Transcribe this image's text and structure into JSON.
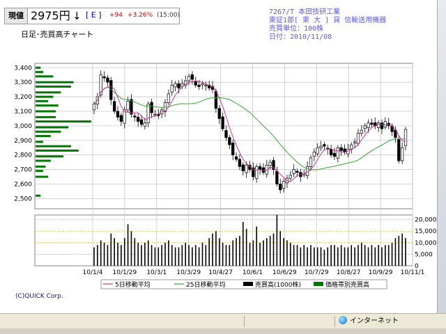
{
  "header": {
    "label": "現値",
    "price": "2975円",
    "arrow": "↓",
    "market_tag": "[ E ]",
    "change": "+94",
    "change_pct": "+3.26%",
    "time": "(15:00)"
  },
  "chart_title": "日足･売買高チャート",
  "info": {
    "code_name": "7267/T 本田技研工業",
    "market": "東証1部[ 東 大 ] 貸 信輸送用機器",
    "unit": "売買単位：100株",
    "date": "日付：2010/11/08"
  },
  "copyright": "(C)QUICK Corp.",
  "statusbar": {
    "internet": "インターネット"
  },
  "colors": {
    "candle": "#000000",
    "ma5": "#cc3399",
    "ma25": "#33aa33",
    "volume": "#000000",
    "price_volume": "#007700",
    "grid": "#c8c8c8",
    "volume_guide": "#e8b800"
  },
  "chart_data": {
    "type": "candlestick",
    "price_axis": {
      "ticks": [
        2500,
        2600,
        2700,
        2800,
        2900,
        3000,
        3100,
        3200,
        3300,
        3400
      ],
      "tick_labels": [
        "2,500",
        "2,600",
        "2,700",
        "2,800",
        "2,900",
        "3,000",
        "3,100",
        "3,200",
        "3,300",
        "3,400"
      ],
      "ylim": [
        2430,
        3430
      ]
    },
    "volume_axis": {
      "ticks": [
        0,
        5000,
        10000,
        15000,
        20000
      ],
      "tick_labels": [
        "0",
        "5,000",
        "10,000",
        "15,000",
        "20,000"
      ],
      "ylim": [
        0,
        22000
      ]
    },
    "x_ticks": [
      "10/1/4",
      "10/1/29",
      "10/3/1",
      "10/3/29",
      "10/4/27",
      "10/6/1",
      "10/6/29",
      "10/7/29",
      "10/8/27",
      "10/9/29",
      "10/11/1"
    ],
    "close": [
      3150,
      3200,
      3350,
      3330,
      3300,
      3180,
      3100,
      3060,
      3030,
      3110,
      3170,
      3080,
      3060,
      3030,
      3010,
      3020,
      3150,
      3090,
      3080,
      3070,
      3110,
      3160,
      3220,
      3280,
      3290,
      3260,
      3290,
      3310,
      3340,
      3320,
      3280,
      3270,
      3290,
      3280,
      3260,
      3250,
      3120,
      3050,
      2980,
      2920,
      2870,
      2800,
      2770,
      2720,
      2690,
      2730,
      2700,
      2650,
      2720,
      2700,
      2680,
      2730,
      2750,
      2700,
      2600,
      2560,
      2620,
      2640,
      2660,
      2700,
      2680,
      2650,
      2670,
      2720,
      2780,
      2820,
      2850,
      2860,
      2860,
      2840,
      2800,
      2790,
      2850,
      2830,
      2820,
      2840,
      2870,
      2890,
      2950,
      2970,
      3000,
      3020,
      3010,
      3000,
      3020,
      2980,
      3030,
      3000,
      2960,
      2920,
      2760,
      2850,
      2975
    ],
    "volume": [
      8000,
      9000,
      11000,
      10000,
      9000,
      14000,
      12000,
      10000,
      9000,
      12000,
      18000,
      15000,
      12000,
      10000,
      9000,
      10000,
      11000,
      9000,
      8000,
      8000,
      9000,
      10000,
      11000,
      9000,
      8000,
      8000,
      9000,
      10000,
      9000,
      8000,
      9000,
      8000,
      10000,
      9000,
      12000,
      14000,
      15000,
      12000,
      10000,
      9000,
      9000,
      11000,
      12000,
      13000,
      19000,
      16000,
      10000,
      11000,
      17000,
      10000,
      11000,
      12000,
      13000,
      14000,
      22000,
      15000,
      12000,
      11000,
      10000,
      9000,
      9000,
      8000,
      9000,
      8000,
      9000,
      8000,
      8000,
      8000,
      7000,
      8000,
      9000,
      9000,
      8000,
      9000,
      8000,
      8000,
      9000,
      8000,
      9000,
      10000,
      9000,
      8000,
      9000,
      8000,
      9000,
      8000,
      9000,
      9000,
      10000,
      12000,
      13000,
      14000,
      12000
    ],
    "price_volume_profile": [
      {
        "price": 3400,
        "volume": 2
      },
      {
        "price": 3370,
        "volume": 3
      },
      {
        "price": 3340,
        "volume": 7
      },
      {
        "price": 3300,
        "volume": 15
      },
      {
        "price": 3270,
        "volume": 14
      },
      {
        "price": 3230,
        "volume": 10
      },
      {
        "price": 3200,
        "volume": 7
      },
      {
        "price": 3170,
        "volume": 5
      },
      {
        "price": 3140,
        "volume": 9
      },
      {
        "price": 3100,
        "volume": 8
      },
      {
        "price": 3060,
        "volume": 8
      },
      {
        "price": 3030,
        "volume": 22
      },
      {
        "price": 2990,
        "volume": 13
      },
      {
        "price": 2960,
        "volume": 10
      },
      {
        "price": 2930,
        "volume": 6
      },
      {
        "price": 2890,
        "volume": 3
      },
      {
        "price": 2860,
        "volume": 14
      },
      {
        "price": 2830,
        "volume": 17
      },
      {
        "price": 2790,
        "volume": 11
      },
      {
        "price": 2760,
        "volume": 6
      },
      {
        "price": 2720,
        "volume": 4
      },
      {
        "price": 2690,
        "volume": 3
      },
      {
        "price": 2650,
        "volume": 5
      },
      {
        "price": 2520,
        "volume": 2
      }
    ],
    "legend": [
      {
        "label": "5日移動平均",
        "kind": "line",
        "color": "#cc3399"
      },
      {
        "label": "25日移動平均",
        "kind": "line",
        "color": "#33aa33"
      },
      {
        "label": "売買高(1000株)",
        "kind": "box",
        "color": "#000000"
      },
      {
        "label": "価格帯別売買高",
        "kind": "box",
        "color": "#007700"
      }
    ]
  }
}
